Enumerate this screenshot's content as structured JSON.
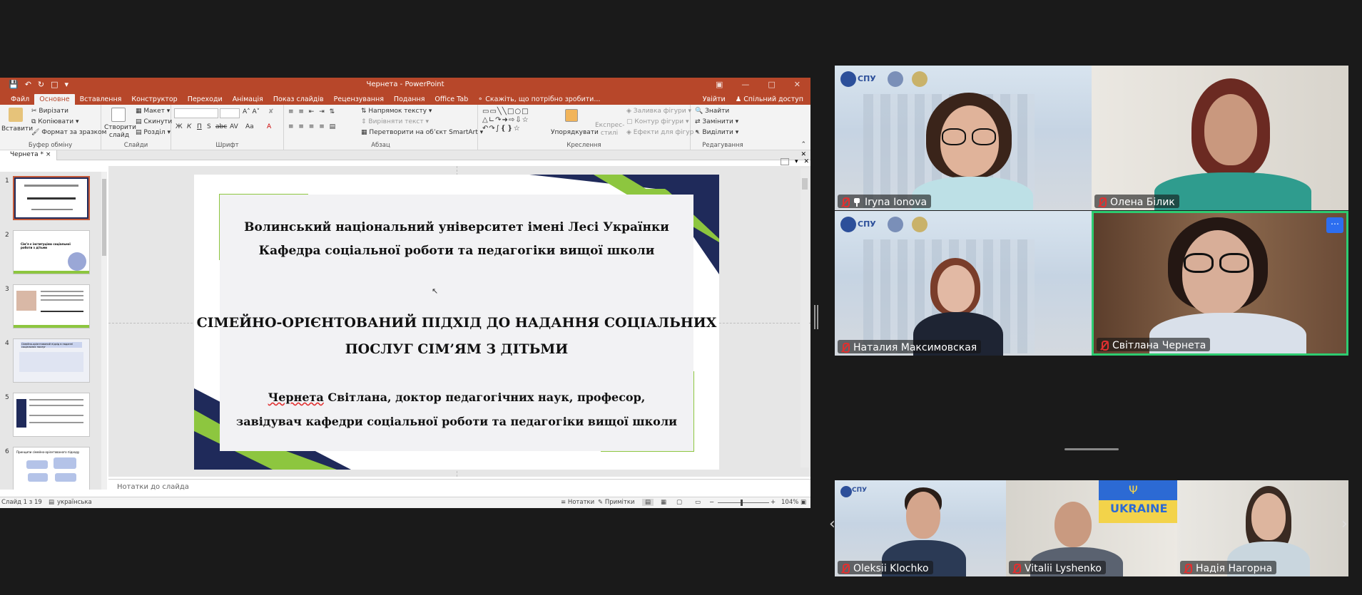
{
  "app": {
    "window_title": "Чернета - PowerPoint",
    "tabs": [
      "Файл",
      "Основне",
      "Вставлення",
      "Конструктор",
      "Переходи",
      "Анімація",
      "Показ слайдів",
      "Рецензування",
      "Подання",
      "Office Tab"
    ],
    "active_tab": "Основне",
    "tell_me": "Скажіть, що потрібно зробити...",
    "sign_in": "Увійти",
    "share": "Спільний доступ"
  },
  "ribbon": {
    "clipboard": {
      "paste": "Вставити",
      "cut": "Вирізати",
      "copy": "Копіювати",
      "format_painter": "Формат за зразком",
      "label": "Буфер обміну"
    },
    "slides": {
      "new_slide": "Створити слайд",
      "layout": "Макет",
      "reset": "Скинути",
      "section": "Розділ",
      "label": "Слайди"
    },
    "font": {
      "label": "Шрифт",
      "bold": "Ж",
      "italic": "К",
      "underline": "П",
      "shadow": "S",
      "strike": "abc",
      "spacing": "AV",
      "case": "Aa",
      "color": "A"
    },
    "paragraph": {
      "text_direction": "Напрямок тексту",
      "align_text": "Вирівняти текст",
      "smartart": "Перетворити на об’єкт SmartArt",
      "label": "Абзац"
    },
    "drawing": {
      "arrange": "Упорядкувати",
      "quick_styles": "Експрес-стилі",
      "shape_fill": "Заливка фігури",
      "shape_outline": "Контур фігури",
      "shape_effects": "Ефекти для фігур",
      "label": "Креслення"
    },
    "editing": {
      "find": "Знайти",
      "replace": "Замінити",
      "select": "Виділити",
      "label": "Редагування"
    }
  },
  "doc_tab": "Чернета *",
  "thumbnails": [
    "1",
    "2",
    "3",
    "4",
    "5",
    "6"
  ],
  "slide": {
    "line1": "Волинський національний університет імені Лесі Українки",
    "line2": "Кафедра соціальної роботи та педагогіки вищої школи",
    "title1": "СІМЕЙНО-ОРІЄНТОВАНИЙ ПІДХІД ДО НАДАННЯ СОЦІАЛЬНИХ",
    "title2": "ПОСЛУГ СІМ’ЯМ З ДІТЬМИ",
    "author_name": "Чернета",
    "author_rest": " Світлана, доктор педагогічних наук, професор,",
    "author2": "завідувач кафедри соціальної роботи та педагогіки вищої школи"
  },
  "notes_placeholder": "Нотатки до слайда",
  "status": {
    "slide": "Слайд 1 з 19",
    "language": "українська",
    "notes": "Нотатки",
    "comments": "Примітки",
    "zoom": "104%"
  },
  "thumb_texts": {
    "t2": "Сім’я є інституцією соціальної роботи з дітьми",
    "t4": "Сімейно-орієнтований підхід в наданні соціальних послуг",
    "t6": "Принципи сімейно-орієнтованого підходу"
  },
  "participants": [
    {
      "name": "Iryna Ionova",
      "muted": true,
      "pinned": true
    },
    {
      "name": "Олена Білик",
      "muted": true
    },
    {
      "name": "Наталия Максимовская",
      "muted": true
    },
    {
      "name": "Світлана Чернета",
      "muted": true,
      "active_speaker": true
    },
    {
      "name": "Oleksii Klochko",
      "muted": true
    },
    {
      "name": "Vitalii Lyshenko",
      "muted": true
    },
    {
      "name": "Надія Нагорна",
      "muted": true
    }
  ],
  "bg_logo": "СПУ",
  "ukraine_banner": "UKRAINE",
  "colors": {
    "ppt_accent": "#b7472a",
    "speaker_border": "#2ecc71",
    "more_button": "#2d6ef0",
    "mic_muted": "#e03030"
  }
}
